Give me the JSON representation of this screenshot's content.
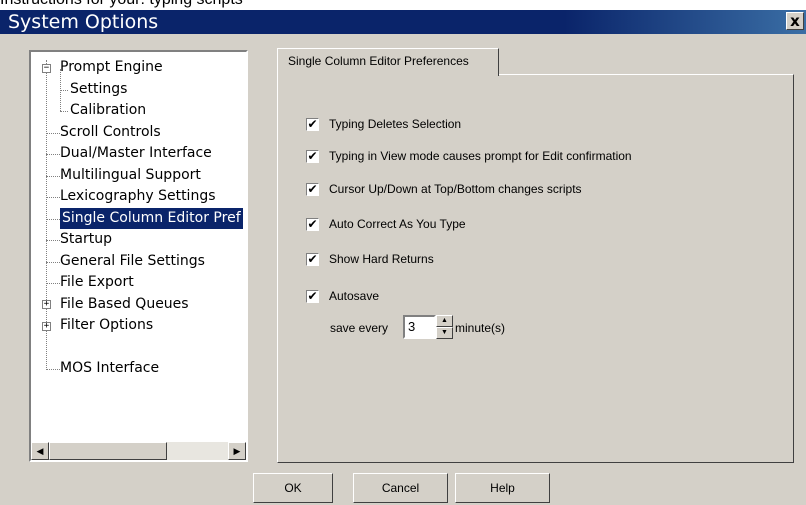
{
  "background_text": "Instructions for your: typing scripts",
  "window": {
    "title": "System Options",
    "close_glyph": "x"
  },
  "tree": {
    "items": [
      {
        "label": "Prompt Engine",
        "expander": "−"
      },
      {
        "label": "Settings"
      },
      {
        "label": "Calibration"
      },
      {
        "label": "Scroll Controls"
      },
      {
        "label": "Dual/Master Interface"
      },
      {
        "label": "Multilingual Support"
      },
      {
        "label": "Lexicography Settings"
      },
      {
        "label": "Single Column Editor Pref",
        "selected": true
      },
      {
        "label": "Startup"
      },
      {
        "label": "General File Settings"
      },
      {
        "label": "File Export"
      },
      {
        "label": "File Based Queues",
        "expander": "+"
      },
      {
        "label": "Filter Options",
        "expander": "+"
      },
      {
        "label": "MOS Interface"
      }
    ]
  },
  "tab": {
    "label": "Single Column Editor Preferences"
  },
  "options": [
    {
      "label": "Typing Deletes Selection",
      "checked": true
    },
    {
      "label": "Typing in View mode causes prompt for Edit confirmation",
      "checked": true
    },
    {
      "label": "Cursor Up/Down at Top/Bottom changes scripts",
      "checked": true
    },
    {
      "label": "Auto Correct As You Type",
      "checked": true
    },
    {
      "label": "Show Hard Returns",
      "checked": true
    },
    {
      "label": "Autosave",
      "checked": true
    }
  ],
  "autosave": {
    "prefix": "save every",
    "value": "3",
    "unit": "minute(s)"
  },
  "buttons": {
    "ok": "OK",
    "cancel": "Cancel",
    "help": "Help"
  },
  "icons": {
    "check": "✔",
    "scroll_left": "◀",
    "scroll_right": "▶",
    "spin_up": "▲",
    "spin_down": "▼"
  }
}
